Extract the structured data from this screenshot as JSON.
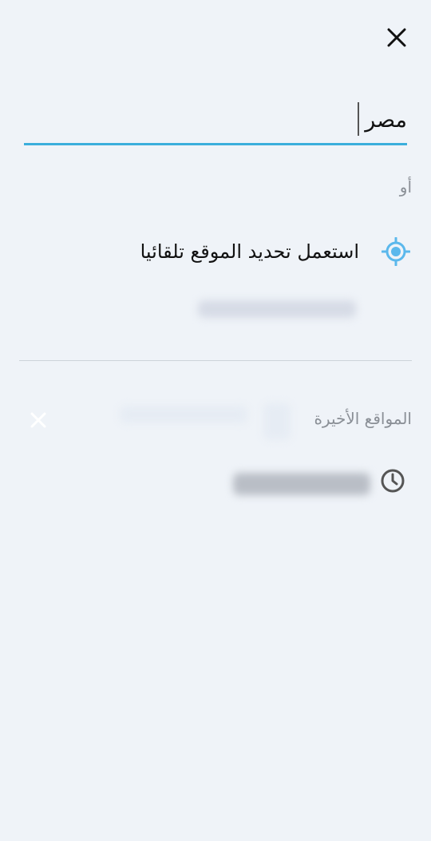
{
  "search": {
    "value": "مصر",
    "accent_color": "#3aaedc"
  },
  "separator": {
    "or_label": "أو"
  },
  "auto_location": {
    "label": "استعمل تحديد الموقع تلقائيا",
    "icon": "gps-target-icon",
    "icon_color": "#5bb8ec"
  },
  "recent": {
    "header": "المواقع الأخيرة",
    "clear_icon": "close-icon",
    "items_icon": "clock-icon"
  },
  "header": {
    "close_icon": "close-icon"
  }
}
